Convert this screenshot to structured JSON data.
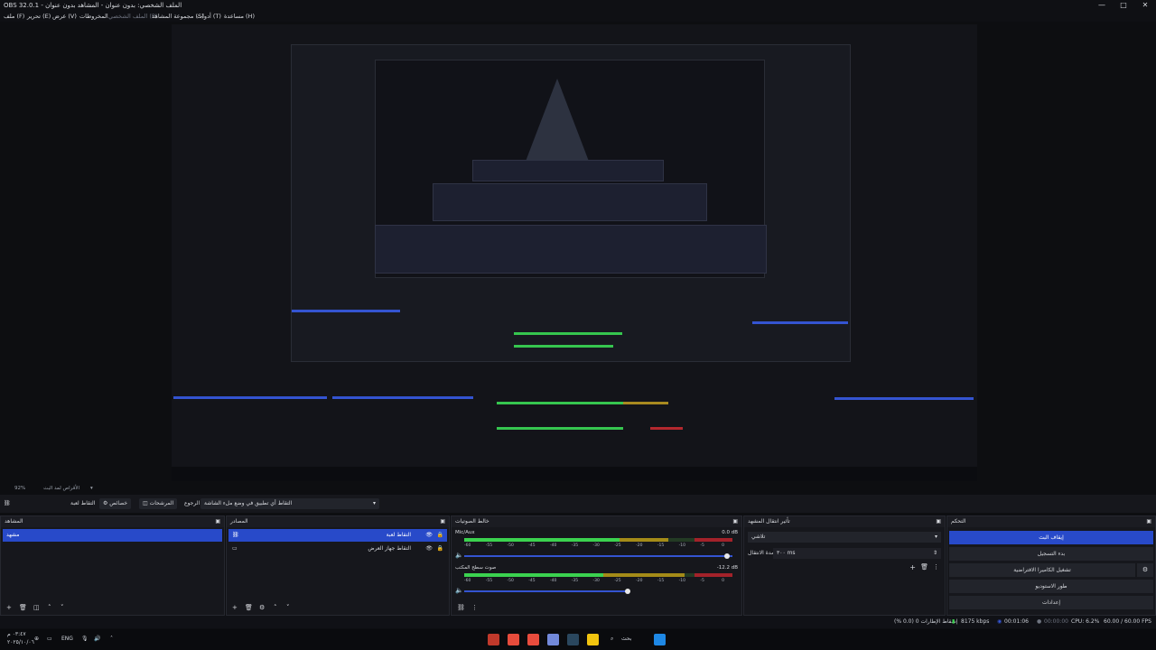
{
  "window": {
    "title": "OBS 32.0.1 - الملف الشخصي: بدون عنوان - المشاهد بدون عنوان",
    "controls": [
      "—",
      "□",
      "✕"
    ]
  },
  "menubar": {
    "items": [
      "ملف (F)",
      "تحرير (E)",
      "عرض (V)",
      "المخروطات",
      "الملف الشخصي (P)",
      "مجموعة المشاهد (S)",
      "أدوات (T)",
      "مساعدة (H)"
    ]
  },
  "viewbar": {
    "zoom": "92%",
    "label": "الأقراص لمد البث"
  },
  "toolbar": {
    "properties_label": "خصائص",
    "filters_label": "المرشحات",
    "source_type_label": "الرجوع",
    "source_combo": "التقاط أي تطبيق في وضع ملء الشاشة",
    "right_label": "التقاط لعبة"
  },
  "docks": {
    "scenes": {
      "title": "المشاهد",
      "items": [
        "مشهد"
      ]
    },
    "sources": {
      "title": "المصادر",
      "items": [
        "التقاط لعبة",
        "التقاط جهاز العرض"
      ]
    },
    "mixer": {
      "title": "خالط الصوتيات",
      "tracks": [
        {
          "name": "Mic/Aux",
          "db": "0.0 dB",
          "level": 0.62
        },
        {
          "name": "صوت سطح المكتب",
          "db": "-12.2 dB",
          "level": 0.51
        }
      ],
      "ticks": [
        "-60",
        "-55",
        "-50",
        "-45",
        "-40",
        "-35",
        "-30",
        "-25",
        "-20",
        "-15",
        "-10",
        "-5",
        "0"
      ]
    },
    "transitions": {
      "title": "تأثير انتقال المشهد",
      "transition": "تلاشي",
      "duration_label": "مدة الانتقال",
      "duration_value": "٣٠٠ ms"
    },
    "controls": {
      "title": "التحكم",
      "buttons": [
        "إيقاف البث",
        "بدء التسجيل",
        "تشغيل الكاميرا الافتراضية",
        "طور الاستوديو",
        "إعدادات"
      ]
    }
  },
  "status": {
    "dropped": "إسقاط الإطارات 0 (0.0 %)",
    "bitrate": "8175 kbps",
    "stream_time": "00:01:06",
    "rec_time": "00:00:00",
    "cpu": "CPU: 6.2%",
    "fps": "60.00 / 60.00 FPS"
  },
  "taskbar": {
    "time": "٠٣:٤٧ م",
    "date": "٢٠٢٥/١٠/٠٦",
    "lang": "ENG",
    "search": "بحث",
    "icon_colors": [
      "#c0392b",
      "#e74c3c",
      "#e84c3d",
      "#7289da",
      "#2a475e",
      "#f1c40f",
      "#ffffff",
      "#1e88e5"
    ]
  }
}
